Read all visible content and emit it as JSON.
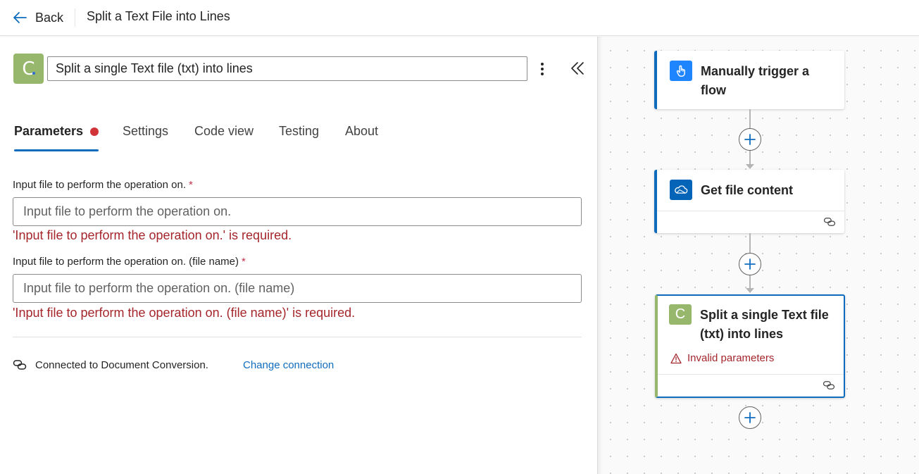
{
  "topbar": {
    "back_label": "Back",
    "title": "Split a Text File into Lines"
  },
  "action": {
    "logo_letter": "C",
    "name_value": "Split a single Text file (txt) into lines"
  },
  "tabs": [
    {
      "label": "Parameters"
    },
    {
      "label": "Settings"
    },
    {
      "label": "Code view"
    },
    {
      "label": "Testing"
    },
    {
      "label": "About"
    }
  ],
  "fields": [
    {
      "label": "Input file to perform the operation on.",
      "required_mark": "*",
      "placeholder": "Input file to perform the operation on.",
      "error": "'Input file to perform the operation on.' is required."
    },
    {
      "label": "Input file to perform the operation on. (file name)",
      "required_mark": "*",
      "placeholder": "Input file to perform the operation on. (file name)",
      "error": "'Input file to perform the operation on. (file name)' is required."
    }
  ],
  "connection": {
    "text": "Connected to Document Conversion.",
    "change_label": "Change connection"
  },
  "flow": {
    "trigger": {
      "title_line1": "Manually trigger a",
      "title_line2": "flow",
      "icon": "hand-pointer-icon",
      "color": "#1f85ff"
    },
    "step1": {
      "title": "Get file content",
      "icon": "onedrive-cloud-icon",
      "color": "#0364b8"
    },
    "step2": {
      "title_line1": "Split a single Text file",
      "title_line2": "(txt) into lines",
      "warning": "Invalid parameters",
      "logo_letter": "C",
      "color": "#97b86c"
    }
  },
  "colors": {
    "accent": "#0f6cbd",
    "error": "#a4262c",
    "error_dot": "#d13438"
  }
}
